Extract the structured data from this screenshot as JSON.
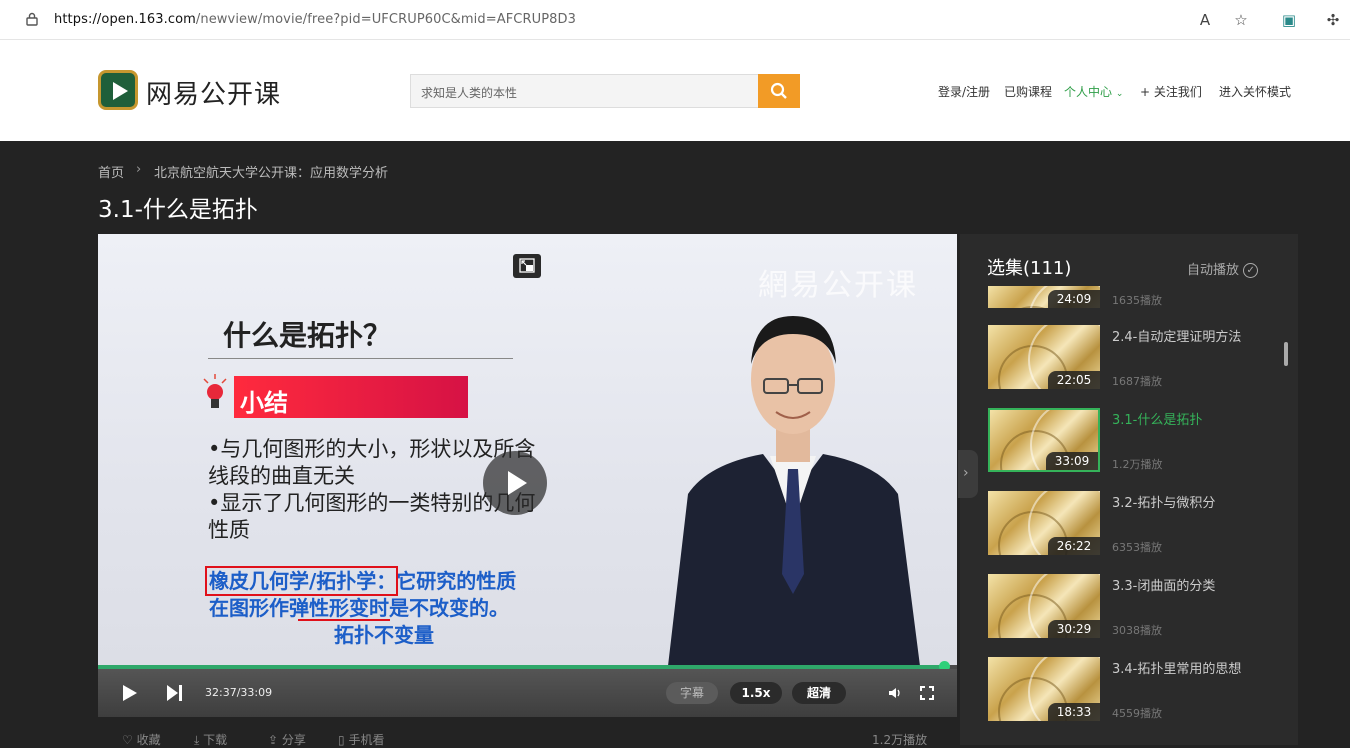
{
  "browser": {
    "url_host": "https://open.163.com",
    "url_path": "/newview/movie/free?pid=UFCRUP60C&mid=AFCRUP8D3"
  },
  "header": {
    "logo_text": "网易公开课",
    "search_placeholder": "求知是人类的本性",
    "nav": {
      "login": "登录/注册",
      "purchased": "已购课程",
      "personal": "个人中心",
      "follow": "+ 关注我们",
      "care_mode": "进入关怀模式"
    }
  },
  "breadcrumb": {
    "home": "首页",
    "separator": "›",
    "course": "北京航空航天大学公开课：应用数学分析"
  },
  "page_title": "3.1-什么是拓扑",
  "video": {
    "watermark": "網易公开课",
    "slide": {
      "title": "什么是拓扑？",
      "section": "小结",
      "bullets": [
        "•与几何图形的大小，形状以及所含",
        "线段的曲直无关",
        "•显示了几何图形的一类特别的几何",
        "性质"
      ],
      "blue_lines": [
        "橡皮几何学/拓扑学：它研究的性质",
        "在图形作弹性形变时是不改变的。",
        "拓扑不变量"
      ]
    },
    "progress_fraction": 0.985,
    "time": "32:37/33:09",
    "subtitle_label": "字幕",
    "speed_label": "1.5x",
    "quality_label": "超清"
  },
  "playlist": {
    "title": "选集(111)",
    "autoplay_label": "自动播放",
    "episodes": [
      {
        "title": "",
        "duration": "24:09",
        "plays": "1635播放",
        "active": false
      },
      {
        "title": "2.4-自动定理证明方法",
        "duration": "22:05",
        "plays": "1687播放",
        "active": false
      },
      {
        "title": "3.1-什么是拓扑",
        "duration": "33:09",
        "plays": "1.2万播放",
        "active": true
      },
      {
        "title": "3.2-拓扑与微积分",
        "duration": "26:22",
        "plays": "6353播放",
        "active": false
      },
      {
        "title": "3.3-闭曲面的分类",
        "duration": "30:29",
        "plays": "3038播放",
        "active": false
      },
      {
        "title": "3.4-拓扑里常用的思想",
        "duration": "18:33",
        "plays": "4559播放",
        "active": false
      }
    ]
  },
  "actions": {
    "favorite": "收藏",
    "download": "下载",
    "share": "分享",
    "mobile": "手机看",
    "plays": "1.2万播放"
  }
}
